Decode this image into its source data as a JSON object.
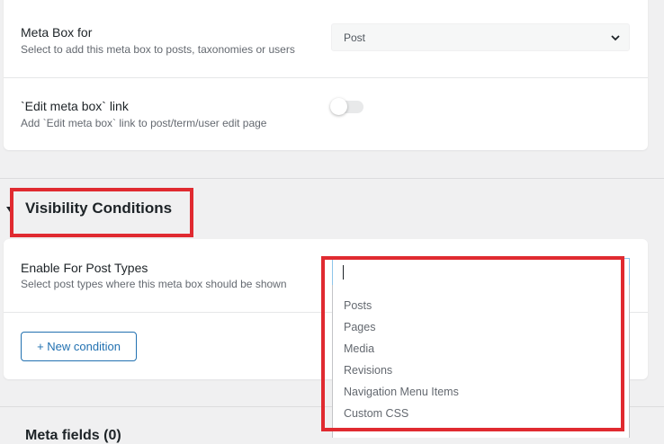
{
  "settings": {
    "meta_box_for": {
      "label": "Meta Box for",
      "description": "Select to add this meta box to posts, taxonomies or users",
      "selected": "Post"
    },
    "edit_link": {
      "label": "`Edit meta box` link",
      "description": "Add `Edit meta box` link to post/term/user edit page",
      "enabled": false
    }
  },
  "visibility": {
    "title": "Visibility Conditions",
    "post_types": {
      "label": "Enable For Post Types",
      "description": "Select post types where this meta box should be shown",
      "search_value": "",
      "options": [
        "Posts",
        "Pages",
        "Media",
        "Revisions",
        "Navigation Menu Items",
        "Custom CSS"
      ]
    },
    "new_condition_label": "+ New condition"
  },
  "footer": {
    "title": "Meta fields (0)"
  },
  "colors": {
    "accent": "#2271b1",
    "highlight": "#e02a30"
  }
}
